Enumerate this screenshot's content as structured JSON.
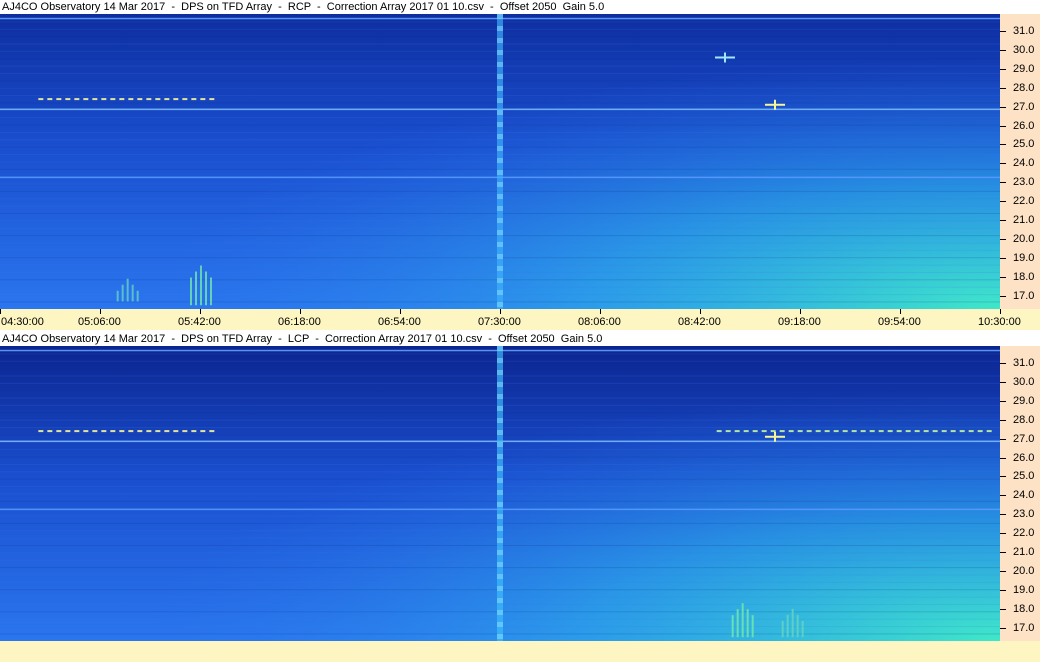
{
  "chart_data": [
    {
      "type": "heatmap",
      "title": "AJ4CO Observatory 14 Mar 2017  -  DPS on TFD Array  -  RCP  -  Correction Array 2017 01 10.csv  -  Offset 2050  Gain 5.0",
      "y_ticks": [
        "31.0",
        "30.0",
        "29.0",
        "28.0",
        "27.0",
        "26.0",
        "25.0",
        "24.0",
        "23.0",
        "22.0",
        "21.0",
        "20.0",
        "19.0",
        "18.0",
        "17.0"
      ],
      "ylim": [
        16.3,
        31.9
      ],
      "x_ticks": [
        "04:30:00",
        "05:06:00",
        "05:42:00",
        "06:18:00",
        "06:54:00",
        "07:30:00",
        "08:06:00",
        "08:42:00",
        "09:18:00",
        "09:54:00",
        "10:30:00"
      ],
      "xlim": [
        "04:30:00",
        "10:30:00"
      ],
      "colors": {
        "background": "#1a56d6",
        "dark": "#0e2ea0",
        "bright": "#3fe8c8",
        "hot": "#f6f59a"
      },
      "bright_corner": "bottom-right",
      "features": [
        {
          "kind": "hline",
          "freq": 31.7,
          "color": "#66a8ff"
        },
        {
          "kind": "hline",
          "freq": 26.9,
          "color": "#7fc0ff"
        },
        {
          "kind": "hline",
          "freq": 23.3,
          "color": "#5a9cff"
        },
        {
          "kind": "vline",
          "time": 7.5,
          "color": "#3fb4ff"
        },
        {
          "kind": "dash",
          "freq": 27.4,
          "t0": 4.73,
          "t1": 5.8,
          "color": "#f6f59a"
        },
        {
          "kind": "spot",
          "freq": 27.1,
          "time": 9.15,
          "color": "#f6f59a"
        },
        {
          "kind": "spot",
          "freq": 29.6,
          "time": 8.85,
          "color": "#9fe8ff"
        },
        {
          "kind": "burst",
          "freq0": 16.5,
          "freq1": 18.6,
          "time": 5.7,
          "color": "#78f0a8"
        },
        {
          "kind": "burst",
          "freq0": 16.7,
          "freq1": 17.9,
          "time": 5.26,
          "color": "#6ad8c0"
        }
      ]
    },
    {
      "type": "heatmap",
      "title": "AJ4CO Observatory 14 Mar 2017  -  DPS on TFD Array  -  LCP  -  Correction Array 2017 01 10.csv  -  Offset 2050  Gain 5.0",
      "y_ticks": [
        "31.0",
        "30.0",
        "29.0",
        "28.0",
        "27.0",
        "26.0",
        "25.0",
        "24.0",
        "23.0",
        "22.0",
        "21.0",
        "20.0",
        "19.0",
        "18.0",
        "17.0"
      ],
      "ylim": [
        16.3,
        31.9
      ],
      "x_ticks": [],
      "xlim": [
        "04:30:00",
        "10:30:00"
      ],
      "colors": {
        "background": "#1a56d6",
        "dark": "#0c2590",
        "bright": "#3fe8c8",
        "hot": "#f6f59a"
      },
      "bright_corner": "bottom-right",
      "features": [
        {
          "kind": "hline",
          "freq": 31.7,
          "color": "#66a8ff"
        },
        {
          "kind": "hline",
          "freq": 26.9,
          "color": "#7fc0ff"
        },
        {
          "kind": "hline",
          "freq": 23.3,
          "color": "#5a9cff"
        },
        {
          "kind": "vline",
          "time": 7.5,
          "color": "#3fc0ff"
        },
        {
          "kind": "dash",
          "freq": 27.4,
          "t0": 4.73,
          "t1": 5.8,
          "color": "#f6f59a"
        },
        {
          "kind": "dash",
          "freq": 27.4,
          "t0": 8.8,
          "t1": 10.45,
          "color": "#c8f4a0"
        },
        {
          "kind": "spot",
          "freq": 27.1,
          "time": 9.15,
          "color": "#f6f59a"
        },
        {
          "kind": "burst",
          "freq0": 16.5,
          "freq1": 18.3,
          "time": 8.95,
          "color": "#78f0a8"
        },
        {
          "kind": "burst",
          "freq0": 16.5,
          "freq1": 18.0,
          "time": 9.25,
          "color": "#6ad8c0"
        }
      ]
    }
  ]
}
